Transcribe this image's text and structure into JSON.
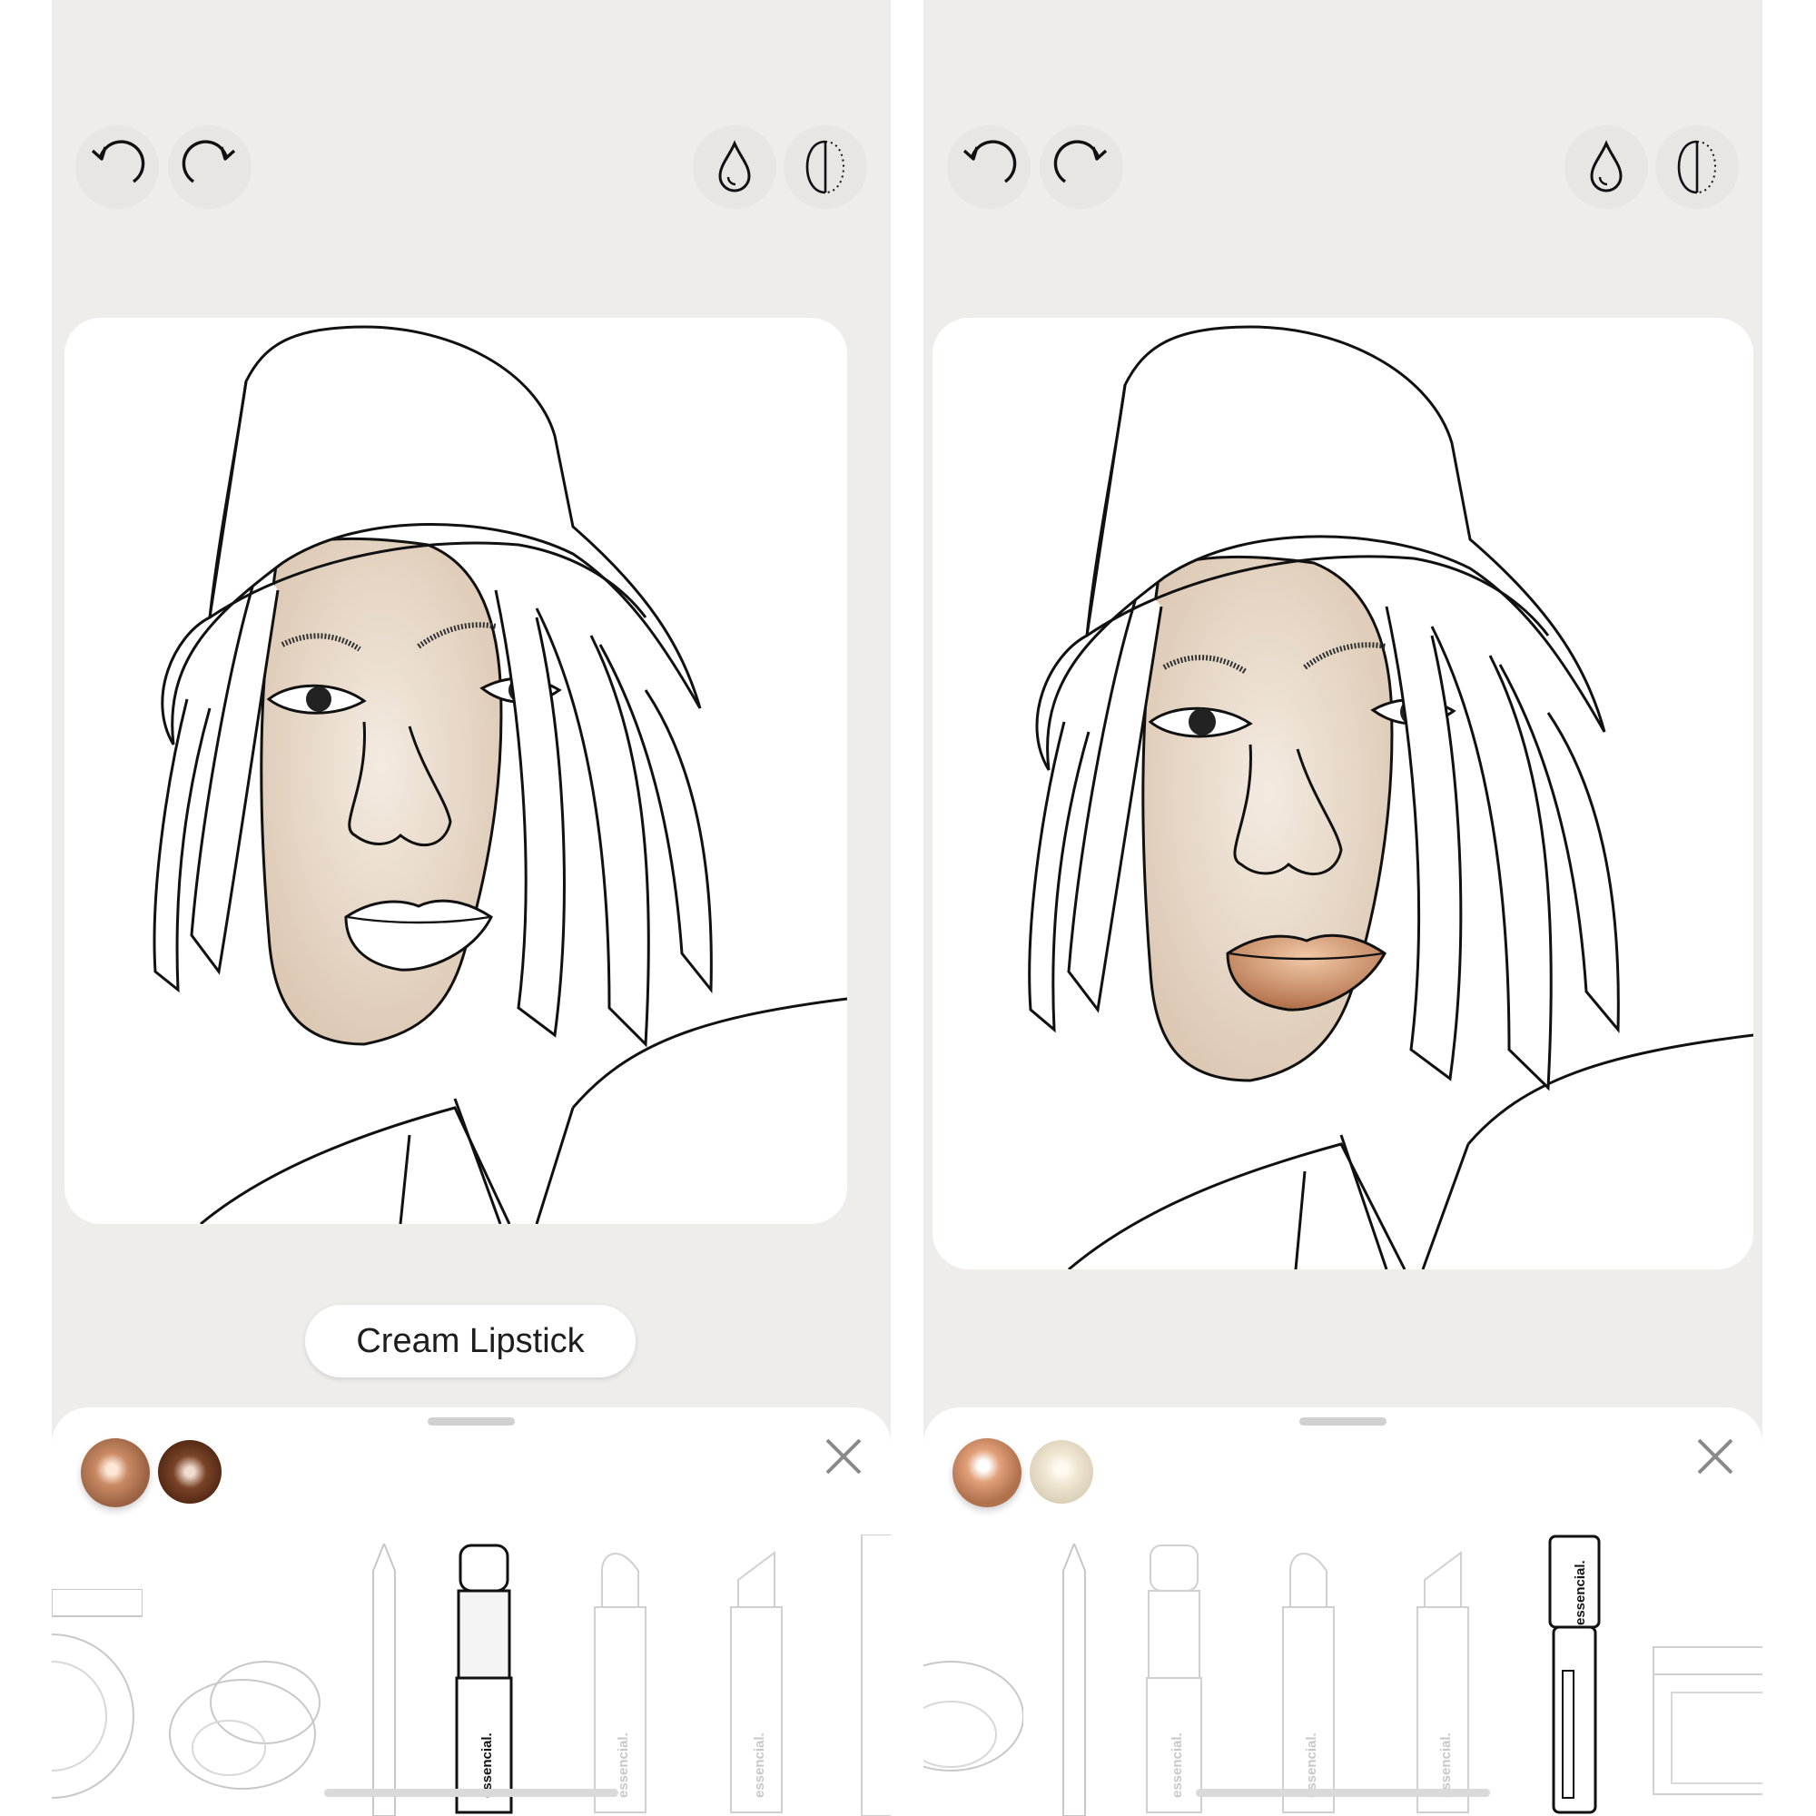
{
  "screens": [
    {
      "id": "left",
      "toolbar": {
        "undo": {
          "icon": "undo-icon"
        },
        "redo": {
          "icon": "redo-icon"
        },
        "intensity": {
          "icon": "drop-icon"
        },
        "compare": {
          "icon": "half-face-icon"
        }
      },
      "product_label": "Cream Lipstick",
      "applied_lip_color": "#ffffff",
      "swatches": [
        {
          "name": "copper-shimmer",
          "color": "#c98a63",
          "selected": true
        },
        {
          "name": "brown-shimmer",
          "color": "#6b3a22",
          "selected": false
        }
      ],
      "close_icon": "close-icon",
      "products": {
        "selected": "cream-lipstick",
        "brand": "essencial."
      }
    },
    {
      "id": "right",
      "toolbar": {
        "undo": {
          "icon": "undo-icon"
        },
        "redo": {
          "icon": "redo-icon"
        },
        "intensity": {
          "icon": "drop-icon"
        },
        "compare": {
          "icon": "half-face-icon"
        }
      },
      "applied_lip_color": "#c98a63",
      "swatches": [
        {
          "name": "copper-shimmer",
          "color": "#c98a63",
          "selected": true
        },
        {
          "name": "champagne-shimmer",
          "color": "#ece3cf",
          "selected": false
        }
      ],
      "close_icon": "close-icon",
      "products": {
        "selected": "lip-gloss",
        "brand": "essencial."
      }
    }
  ],
  "colors": {
    "app_background": "#eeedea",
    "skin": "#eadccc",
    "line": "#111111"
  }
}
